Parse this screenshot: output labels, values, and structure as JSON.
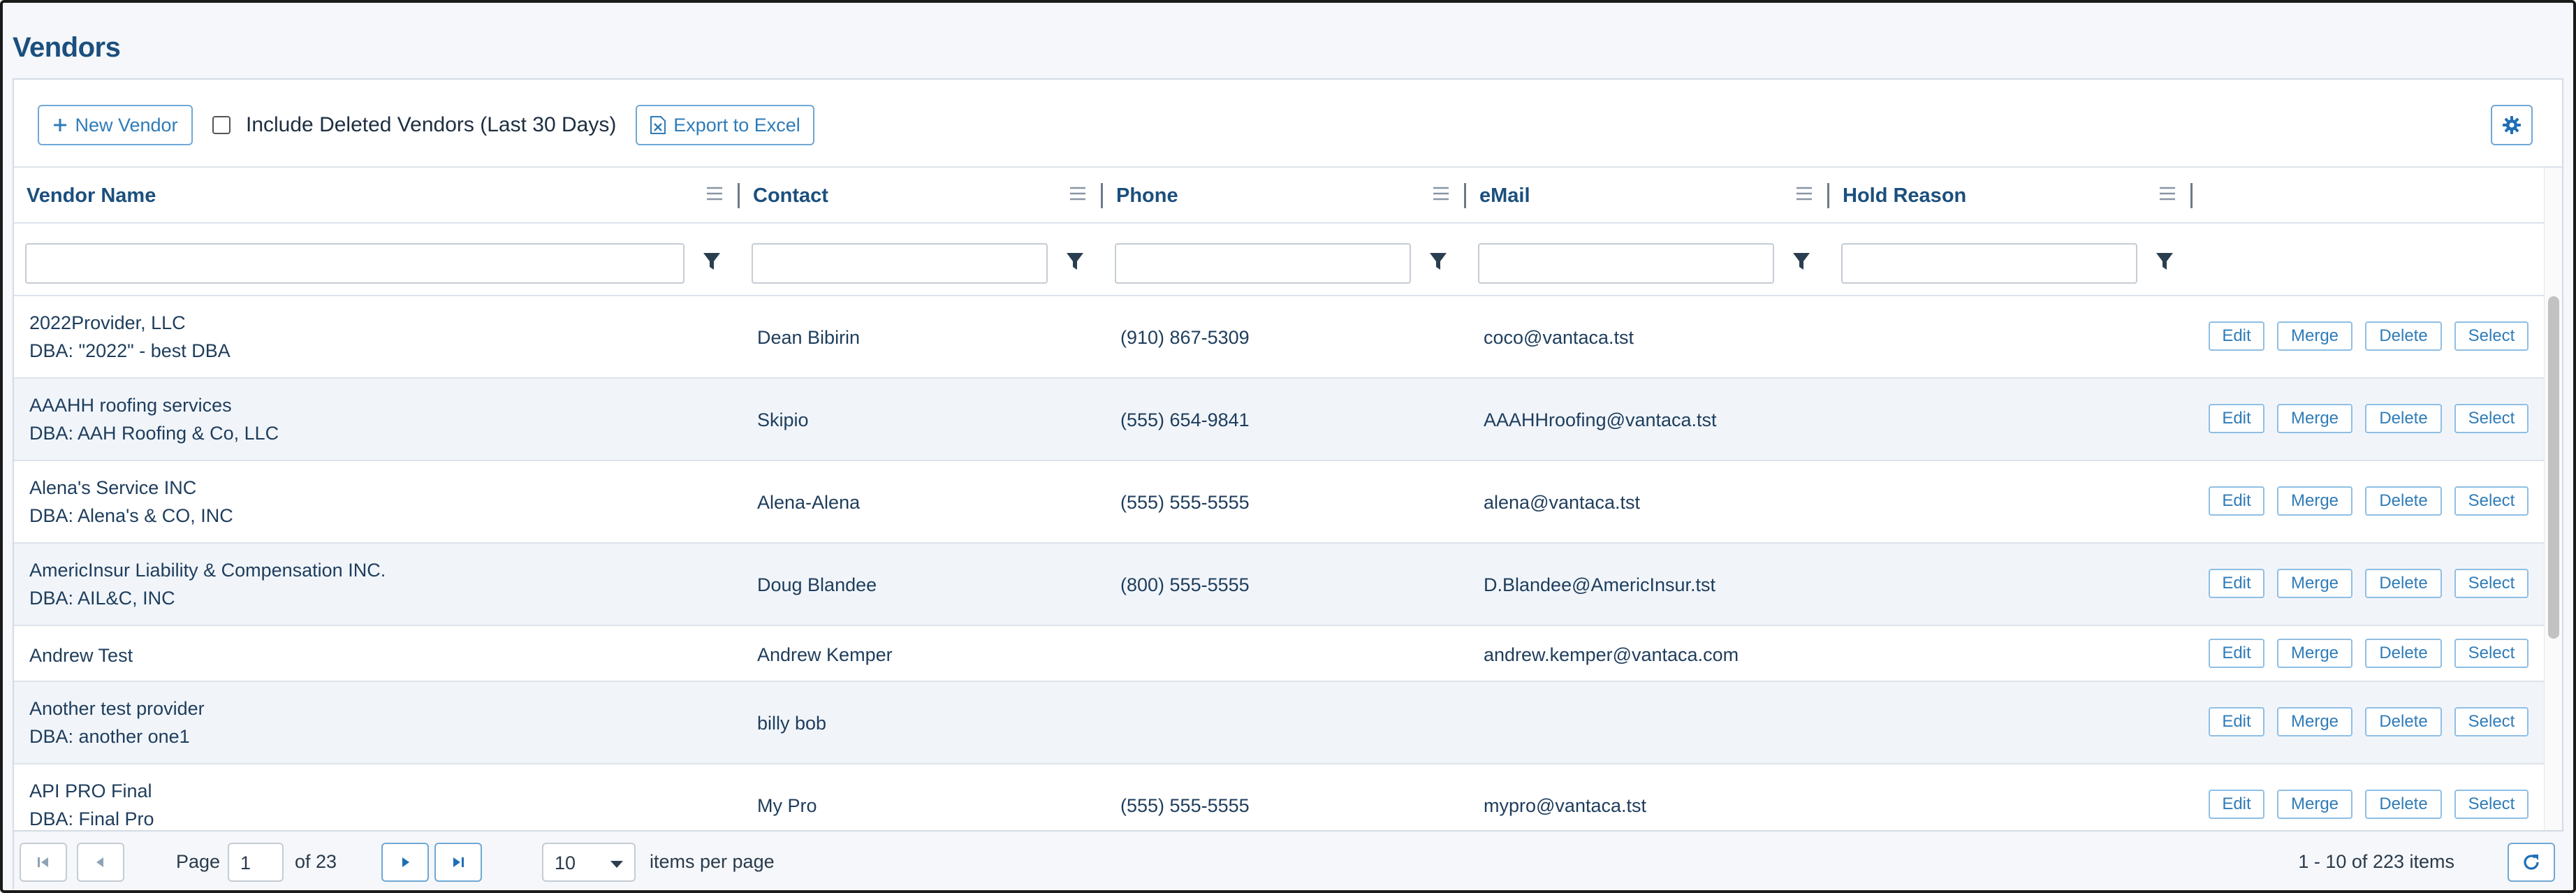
{
  "page": {
    "title": "Vendors"
  },
  "toolbar": {
    "new_vendor_label": "New Vendor",
    "include_deleted_label": "Include Deleted Vendors (Last 30 Days)",
    "include_deleted_checked": false,
    "export_label": "Export to Excel"
  },
  "columns": [
    {
      "label": "Vendor Name"
    },
    {
      "label": "Contact"
    },
    {
      "label": "Phone"
    },
    {
      "label": "eMail"
    },
    {
      "label": "Hold Reason"
    }
  ],
  "row_actions": {
    "edit": "Edit",
    "merge": "Merge",
    "delete": "Delete",
    "select": "Select"
  },
  "rows": [
    {
      "name": "2022Provider, LLC",
      "dba": "DBA: \"2022\" - best DBA",
      "contact": "Dean Bibirin",
      "phone": "(910) 867-5309",
      "email": "coco@vantaca.tst",
      "hold": ""
    },
    {
      "name": "AAAHH roofing services",
      "dba": "DBA: AAH Roofing & Co, LLC",
      "contact": "Skipio",
      "phone": "(555) 654-9841",
      "email": "AAAHHroofing@vantaca.tst",
      "hold": ""
    },
    {
      "name": "Alena's Service INC",
      "dba": "DBA: Alena's & CO, INC",
      "contact": "Alena-Alena",
      "phone": "(555) 555-5555",
      "email": "alena@vantaca.tst",
      "hold": ""
    },
    {
      "name": "AmericInsur Liability & Compensation INC.",
      "dba": "DBA: AIL&C, INC",
      "contact": "Doug Blandee",
      "phone": "(800) 555-5555",
      "email": "D.Blandee@AmericInsur.tst",
      "hold": ""
    },
    {
      "name": "Andrew Test",
      "dba": "",
      "contact": "Andrew Kemper",
      "phone": "",
      "email": "andrew.kemper@vantaca.com",
      "hold": ""
    },
    {
      "name": "Another test provider",
      "dba": "DBA: another one1",
      "contact": "billy bob",
      "phone": "",
      "email": "",
      "hold": ""
    },
    {
      "name": "API PRO Final",
      "dba": "DBA: Final Pro",
      "contact": "My Pro",
      "phone": "(555) 555-5555",
      "email": "mypro@vantaca.tst",
      "hold": ""
    }
  ],
  "pager": {
    "page_label": "Page",
    "current_page": "1",
    "of_label": "of 23",
    "per_page_value": "10",
    "per_page_label": "items per page",
    "range_label": "1 - 10 of 223 items"
  }
}
